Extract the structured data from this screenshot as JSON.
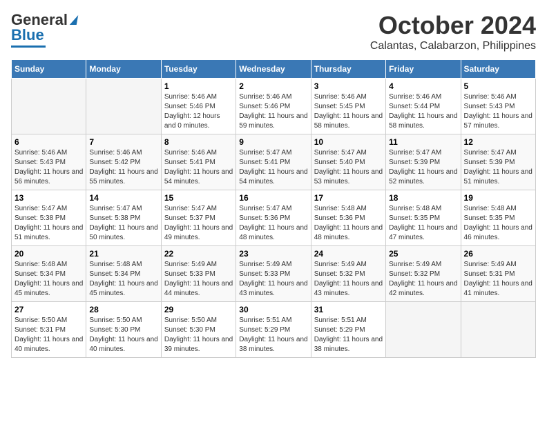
{
  "header": {
    "logo": {
      "line1": "General",
      "line2": "Blue"
    },
    "title": "October 2024",
    "subtitle": "Calantas, Calabarzon, Philippines"
  },
  "columns": [
    "Sunday",
    "Monday",
    "Tuesday",
    "Wednesday",
    "Thursday",
    "Friday",
    "Saturday"
  ],
  "weeks": [
    [
      {
        "day": "",
        "sunrise": "",
        "sunset": "",
        "daylight": "",
        "empty": true
      },
      {
        "day": "",
        "sunrise": "",
        "sunset": "",
        "daylight": "",
        "empty": true
      },
      {
        "day": "1",
        "sunrise": "Sunrise: 5:46 AM",
        "sunset": "Sunset: 5:46 PM",
        "daylight": "Daylight: 12 hours and 0 minutes."
      },
      {
        "day": "2",
        "sunrise": "Sunrise: 5:46 AM",
        "sunset": "Sunset: 5:46 PM",
        "daylight": "Daylight: 11 hours and 59 minutes."
      },
      {
        "day": "3",
        "sunrise": "Sunrise: 5:46 AM",
        "sunset": "Sunset: 5:45 PM",
        "daylight": "Daylight: 11 hours and 58 minutes."
      },
      {
        "day": "4",
        "sunrise": "Sunrise: 5:46 AM",
        "sunset": "Sunset: 5:44 PM",
        "daylight": "Daylight: 11 hours and 58 minutes."
      },
      {
        "day": "5",
        "sunrise": "Sunrise: 5:46 AM",
        "sunset": "Sunset: 5:43 PM",
        "daylight": "Daylight: 11 hours and 57 minutes."
      }
    ],
    [
      {
        "day": "6",
        "sunrise": "Sunrise: 5:46 AM",
        "sunset": "Sunset: 5:43 PM",
        "daylight": "Daylight: 11 hours and 56 minutes."
      },
      {
        "day": "7",
        "sunrise": "Sunrise: 5:46 AM",
        "sunset": "Sunset: 5:42 PM",
        "daylight": "Daylight: 11 hours and 55 minutes."
      },
      {
        "day": "8",
        "sunrise": "Sunrise: 5:46 AM",
        "sunset": "Sunset: 5:41 PM",
        "daylight": "Daylight: 11 hours and 54 minutes."
      },
      {
        "day": "9",
        "sunrise": "Sunrise: 5:47 AM",
        "sunset": "Sunset: 5:41 PM",
        "daylight": "Daylight: 11 hours and 54 minutes."
      },
      {
        "day": "10",
        "sunrise": "Sunrise: 5:47 AM",
        "sunset": "Sunset: 5:40 PM",
        "daylight": "Daylight: 11 hours and 53 minutes."
      },
      {
        "day": "11",
        "sunrise": "Sunrise: 5:47 AM",
        "sunset": "Sunset: 5:39 PM",
        "daylight": "Daylight: 11 hours and 52 minutes."
      },
      {
        "day": "12",
        "sunrise": "Sunrise: 5:47 AM",
        "sunset": "Sunset: 5:39 PM",
        "daylight": "Daylight: 11 hours and 51 minutes."
      }
    ],
    [
      {
        "day": "13",
        "sunrise": "Sunrise: 5:47 AM",
        "sunset": "Sunset: 5:38 PM",
        "daylight": "Daylight: 11 hours and 51 minutes."
      },
      {
        "day": "14",
        "sunrise": "Sunrise: 5:47 AM",
        "sunset": "Sunset: 5:38 PM",
        "daylight": "Daylight: 11 hours and 50 minutes."
      },
      {
        "day": "15",
        "sunrise": "Sunrise: 5:47 AM",
        "sunset": "Sunset: 5:37 PM",
        "daylight": "Daylight: 11 hours and 49 minutes."
      },
      {
        "day": "16",
        "sunrise": "Sunrise: 5:47 AM",
        "sunset": "Sunset: 5:36 PM",
        "daylight": "Daylight: 11 hours and 48 minutes."
      },
      {
        "day": "17",
        "sunrise": "Sunrise: 5:48 AM",
        "sunset": "Sunset: 5:36 PM",
        "daylight": "Daylight: 11 hours and 48 minutes."
      },
      {
        "day": "18",
        "sunrise": "Sunrise: 5:48 AM",
        "sunset": "Sunset: 5:35 PM",
        "daylight": "Daylight: 11 hours and 47 minutes."
      },
      {
        "day": "19",
        "sunrise": "Sunrise: 5:48 AM",
        "sunset": "Sunset: 5:35 PM",
        "daylight": "Daylight: 11 hours and 46 minutes."
      }
    ],
    [
      {
        "day": "20",
        "sunrise": "Sunrise: 5:48 AM",
        "sunset": "Sunset: 5:34 PM",
        "daylight": "Daylight: 11 hours and 45 minutes."
      },
      {
        "day": "21",
        "sunrise": "Sunrise: 5:48 AM",
        "sunset": "Sunset: 5:34 PM",
        "daylight": "Daylight: 11 hours and 45 minutes."
      },
      {
        "day": "22",
        "sunrise": "Sunrise: 5:49 AM",
        "sunset": "Sunset: 5:33 PM",
        "daylight": "Daylight: 11 hours and 44 minutes."
      },
      {
        "day": "23",
        "sunrise": "Sunrise: 5:49 AM",
        "sunset": "Sunset: 5:33 PM",
        "daylight": "Daylight: 11 hours and 43 minutes."
      },
      {
        "day": "24",
        "sunrise": "Sunrise: 5:49 AM",
        "sunset": "Sunset: 5:32 PM",
        "daylight": "Daylight: 11 hours and 43 minutes."
      },
      {
        "day": "25",
        "sunrise": "Sunrise: 5:49 AM",
        "sunset": "Sunset: 5:32 PM",
        "daylight": "Daylight: 11 hours and 42 minutes."
      },
      {
        "day": "26",
        "sunrise": "Sunrise: 5:49 AM",
        "sunset": "Sunset: 5:31 PM",
        "daylight": "Daylight: 11 hours and 41 minutes."
      }
    ],
    [
      {
        "day": "27",
        "sunrise": "Sunrise: 5:50 AM",
        "sunset": "Sunset: 5:31 PM",
        "daylight": "Daylight: 11 hours and 40 minutes."
      },
      {
        "day": "28",
        "sunrise": "Sunrise: 5:50 AM",
        "sunset": "Sunset: 5:30 PM",
        "daylight": "Daylight: 11 hours and 40 minutes."
      },
      {
        "day": "29",
        "sunrise": "Sunrise: 5:50 AM",
        "sunset": "Sunset: 5:30 PM",
        "daylight": "Daylight: 11 hours and 39 minutes."
      },
      {
        "day": "30",
        "sunrise": "Sunrise: 5:51 AM",
        "sunset": "Sunset: 5:29 PM",
        "daylight": "Daylight: 11 hours and 38 minutes."
      },
      {
        "day": "31",
        "sunrise": "Sunrise: 5:51 AM",
        "sunset": "Sunset: 5:29 PM",
        "daylight": "Daylight: 11 hours and 38 minutes."
      },
      {
        "day": "",
        "sunrise": "",
        "sunset": "",
        "daylight": "",
        "empty": true
      },
      {
        "day": "",
        "sunrise": "",
        "sunset": "",
        "daylight": "",
        "empty": true
      }
    ]
  ]
}
